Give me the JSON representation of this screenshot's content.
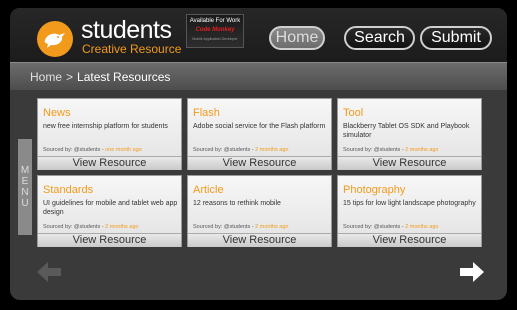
{
  "header": {
    "logo_title": "students",
    "logo_subtitle": "Creative Resource",
    "ad": {
      "line1": "Available For Work",
      "line2": "Code Monkey",
      "line3": "Mobile Application Developer"
    },
    "nav": {
      "home_label": "Home",
      "search_label": "Search",
      "submit_label": "Submit"
    }
  },
  "breadcrumb": {
    "home": "Home",
    "separator": ">",
    "current": "Latest Resources"
  },
  "menu_tab": {
    "letters": [
      "M",
      "E",
      "N",
      "U"
    ]
  },
  "cards": [
    {
      "title": "News",
      "description": "new free internship platform for students",
      "source_label": "Sourced by:",
      "source_user": "@students",
      "source_sep": " - ",
      "ago": "one month ago",
      "button": "View Resource"
    },
    {
      "title": "Flash",
      "description": "Adobe social service for the Flash platform",
      "source_label": "Sourced by:",
      "source_user": "@students",
      "source_sep": " - ",
      "ago": "2 months ago",
      "button": "View Resource"
    },
    {
      "title": "Tool",
      "description": "Blackberry Tablet OS SDK and Playbook simulator",
      "source_label": "Sourced by:",
      "source_user": "@students",
      "source_sep": " - ",
      "ago": "2 months ago",
      "button": "View Resource"
    },
    {
      "title": "Standards",
      "description": "UI guidelines for mobile and tablet web app design",
      "source_label": "Sourced by:",
      "source_user": "@students",
      "source_sep": " - ",
      "ago": "2 months ago",
      "button": "View Resource"
    },
    {
      "title": "Article",
      "description": "12 reasons to rethink mobile",
      "source_label": "Sourced by:",
      "source_user": "@students",
      "source_sep": " - ",
      "ago": "2 months ago",
      "button": "View Resource"
    },
    {
      "title": "Photography",
      "description": "15 tips for low light landscape photography",
      "source_label": "Sourced by:",
      "source_user": "@students",
      "source_sep": " - ",
      "ago": "2 months ago",
      "button": "View Resource"
    }
  ],
  "pager": {
    "prev_icon": "arrow-left-icon",
    "next_icon": "arrow-right-icon"
  },
  "colors": {
    "accent": "#f29a1c",
    "background": "#3a3a3a",
    "header": "#1f1f1f"
  }
}
